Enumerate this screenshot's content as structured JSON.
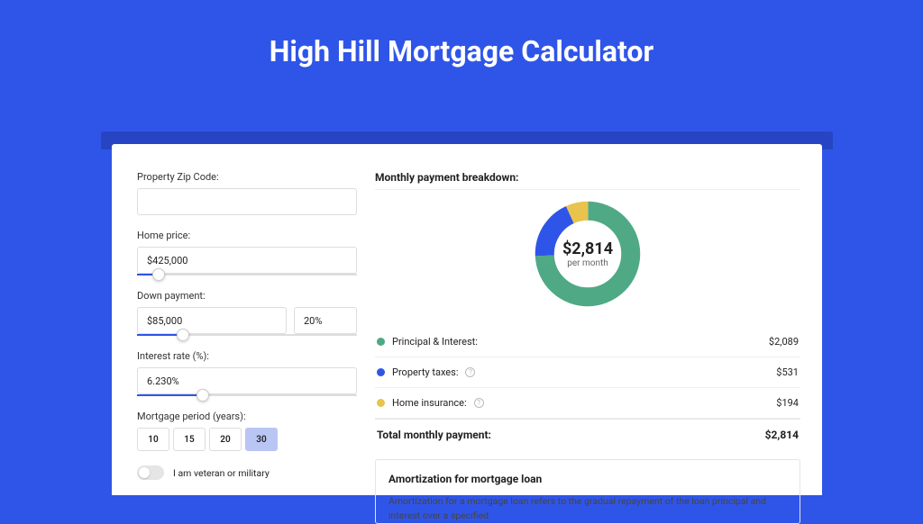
{
  "title": "High Hill Mortgage Calculator",
  "form": {
    "zip_label": "Property Zip Code:",
    "zip_value": "",
    "price_label": "Home price:",
    "price_value": "$425,000",
    "price_slider_pct": 10,
    "down_label": "Down payment:",
    "down_value": "$85,000",
    "down_pct_value": "20%",
    "down_slider_pct": 21,
    "rate_label": "Interest rate (%):",
    "rate_value": "6.230%",
    "rate_slider_pct": 30,
    "period_label": "Mortgage period (years):",
    "periods": [
      "10",
      "15",
      "20",
      "30"
    ],
    "period_selected": "30",
    "vet_label": "I am veteran or military",
    "vet_on": false
  },
  "breakdown": {
    "title": "Monthly payment breakdown:",
    "donut_value": "$2,814",
    "donut_sub": "per month",
    "items": [
      {
        "label": "Principal & Interest:",
        "value": "$2,089",
        "color": "#4fa985",
        "info": false
      },
      {
        "label": "Property taxes:",
        "value": "$531",
        "color": "#2f55e8",
        "info": true
      },
      {
        "label": "Home insurance:",
        "value": "$194",
        "color": "#e8c34d",
        "info": true
      }
    ],
    "total_label": "Total monthly payment:",
    "total_value": "$2,814"
  },
  "amort": {
    "title": "Amortization for mortgage loan",
    "text": "Amortization for a mortgage loan refers to the gradual repayment of the loan principal and interest over a specified"
  },
  "chart_data": {
    "type": "pie",
    "title": "Monthly payment breakdown",
    "categories": [
      "Principal & Interest",
      "Property taxes",
      "Home insurance"
    ],
    "values": [
      2089,
      531,
      194
    ],
    "colors": [
      "#4fa985",
      "#2f55e8",
      "#e8c34d"
    ],
    "total": 2814
  }
}
